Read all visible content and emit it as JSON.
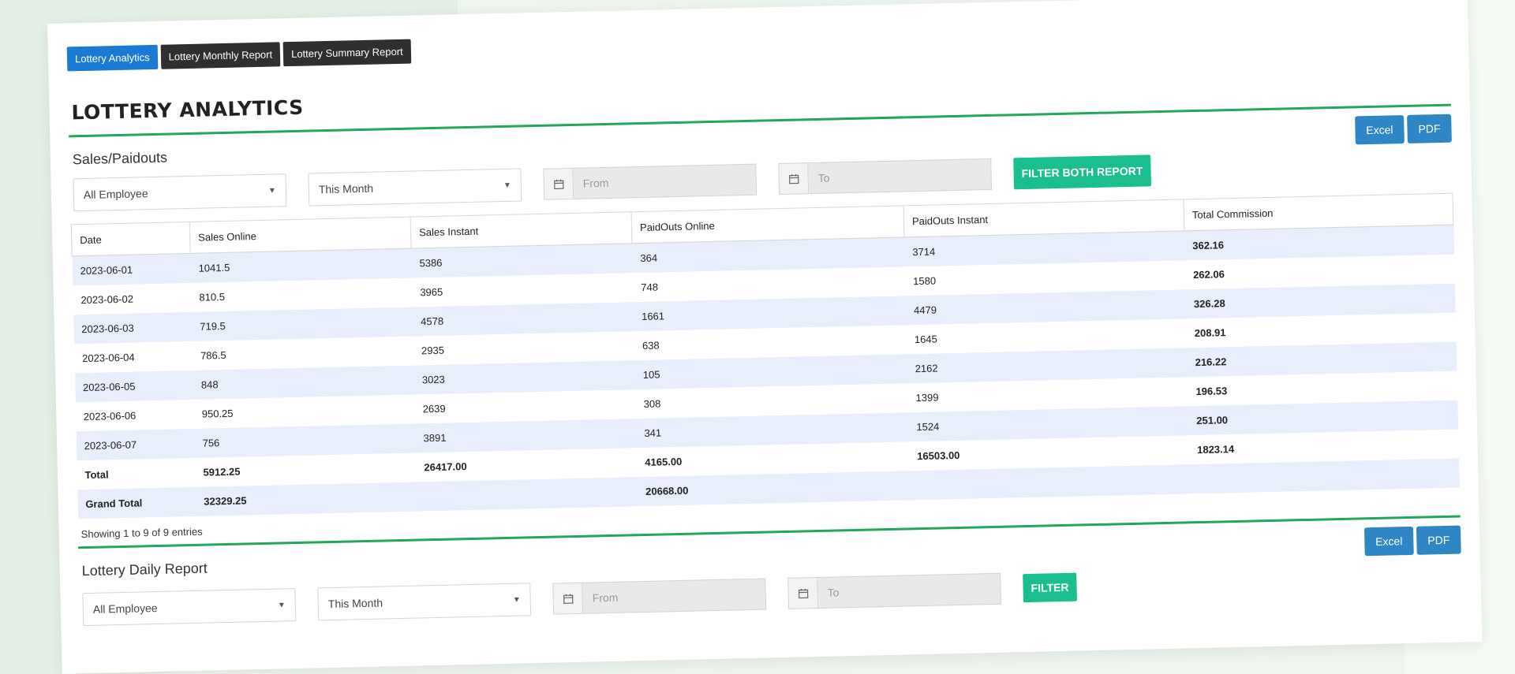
{
  "tabs": [
    "Lottery Analytics",
    "Lottery Monthly Report",
    "Lottery Summary Report"
  ],
  "page_title": "LOTTERY ANALYTICS",
  "sales_section": {
    "title": "Sales/Paidouts",
    "excel_label": "Excel",
    "pdf_label": "PDF",
    "employee_select": "All Employee",
    "period_select": "This Month",
    "from_placeholder": "From",
    "to_placeholder": "To",
    "filter_label": "FILTER BOTH REPORT",
    "columns": [
      "Date",
      "Sales Online",
      "Sales Instant",
      "PaidOuts Online",
      "PaidOuts Instant",
      "Total Commission"
    ],
    "rows": [
      [
        "2023-06-01",
        "1041.5",
        "5386",
        "364",
        "3714",
        "362.16"
      ],
      [
        "2023-06-02",
        "810.5",
        "3965",
        "748",
        "1580",
        "262.06"
      ],
      [
        "2023-06-03",
        "719.5",
        "4578",
        "1661",
        "4479",
        "326.28"
      ],
      [
        "2023-06-04",
        "786.5",
        "2935",
        "638",
        "1645",
        "208.91"
      ],
      [
        "2023-06-05",
        "848",
        "3023",
        "105",
        "2162",
        "216.22"
      ],
      [
        "2023-06-06",
        "950.25",
        "2639",
        "308",
        "1399",
        "196.53"
      ],
      [
        "2023-06-07",
        "756",
        "3891",
        "341",
        "1524",
        "251.00"
      ]
    ],
    "total_row": [
      "Total",
      "5912.25",
      "26417.00",
      "4165.00",
      "16503.00",
      "1823.14"
    ],
    "grand_total_row": [
      "Grand Total",
      "32329.25",
      "",
      "20668.00",
      "",
      ""
    ],
    "showing": "Showing 1 to 9 of 9 entries"
  },
  "daily_section": {
    "title": "Lottery Daily Report",
    "excel_label": "Excel",
    "pdf_label": "PDF",
    "employee_select": "All Employee",
    "period_select": "This Month",
    "from_placeholder": "From",
    "to_placeholder": "To",
    "filter_label": "FILTER"
  },
  "colors": {
    "active_tab": "#1a7ad4",
    "dark_tab": "#2d2f31",
    "rule": "#1fa85a",
    "filter_button": "#1bbf8f",
    "export_button": "#2f86c4",
    "stripe": "#e8eefb"
  }
}
